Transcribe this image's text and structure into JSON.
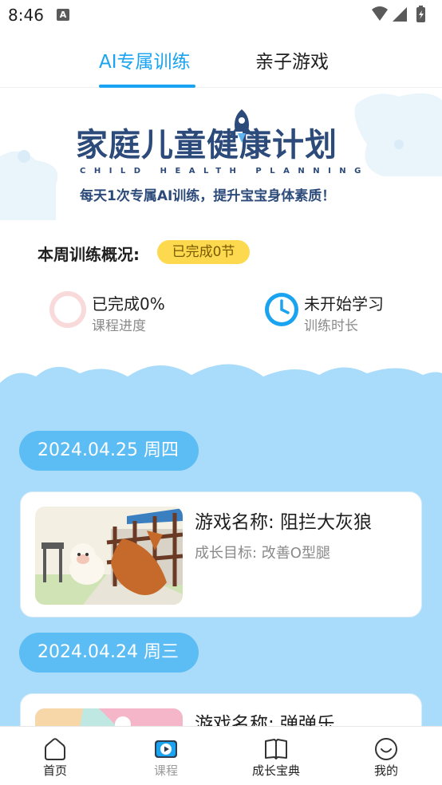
{
  "status_bar": {
    "time": "8:46",
    "notification_icon": "A"
  },
  "tabs": [
    {
      "label": "AI专属训练",
      "active": true
    },
    {
      "label": "亲子游戏",
      "active": false
    }
  ],
  "banner": {
    "title": "家庭儿童健康计划",
    "subtitle_en": "CHILD HEALTH PLANNING",
    "slogan": "每天1次专属AI训练，提升宝宝身体素质！"
  },
  "weekly": {
    "label": "本周训练概况:",
    "badge": "已完成0节",
    "progress": {
      "value": "已完成0%",
      "caption": "课程进度",
      "percent": 0
    },
    "duration": {
      "value": "未开始学习",
      "caption": "训练时长"
    }
  },
  "days": [
    {
      "date": "2024.04.25 周四",
      "game_name": "游戏名称: 阻拦大灰狼",
      "goal": "成长目标: 改善O型腿"
    },
    {
      "date": "2024.04.24 周三",
      "game_name": "游戏名称: 弹弹乐"
    }
  ],
  "bottom_nav": [
    {
      "label": "首页",
      "icon": "home-icon"
    },
    {
      "label": "课程",
      "icon": "course-icon",
      "active": true
    },
    {
      "label": "成长宝典",
      "icon": "book-icon"
    },
    {
      "label": "我的",
      "icon": "smile-icon"
    }
  ],
  "colors": {
    "accent": "#1aa3f0",
    "badge": "#fcd94e",
    "sky": "#a8dcfa",
    "pill": "#5cbcf4"
  }
}
